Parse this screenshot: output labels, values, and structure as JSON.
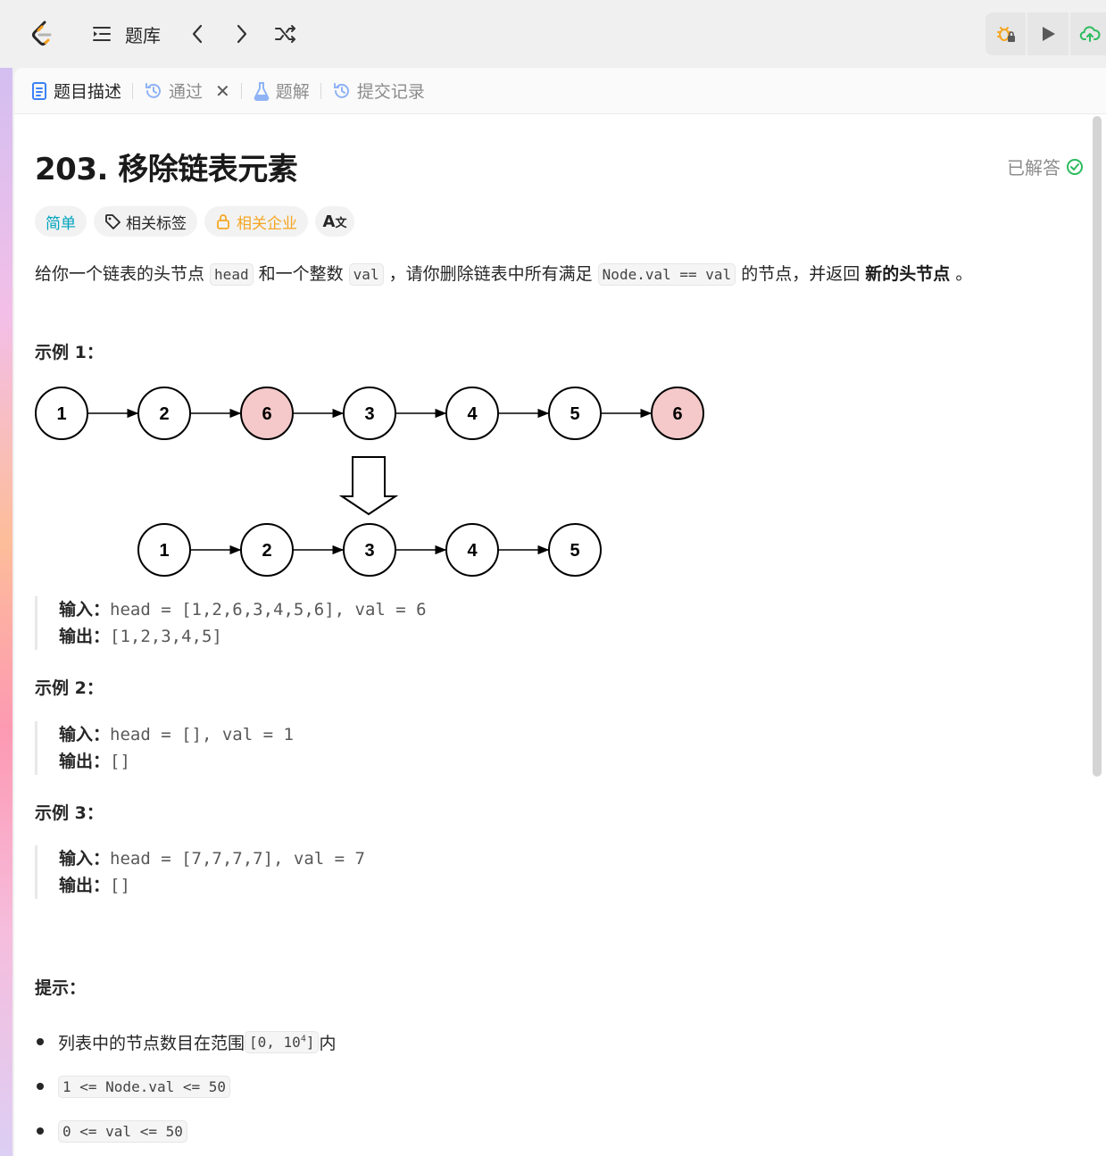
{
  "navbar": {
    "title": "题库",
    "icons": [
      "leetcode-logo",
      "list-icon",
      "chevron-left-icon",
      "chevron-right-icon",
      "shuffle-icon",
      "debug-icon",
      "run-icon",
      "upload-icon"
    ]
  },
  "tabs": [
    {
      "label": "题目描述",
      "icon": "description-icon"
    },
    {
      "label": "通过",
      "icon": "history-icon"
    },
    {
      "label": "题解",
      "icon": "flask-icon"
    },
    {
      "label": "提交记录",
      "icon": "history-icon"
    }
  ],
  "problem": {
    "title": "203. 移除链表元素",
    "status": "已解答",
    "tags": {
      "difficulty": "简单",
      "topics": "相关标签",
      "companies": "相关企业",
      "lang": "A"
    },
    "desc": {
      "p1": "给你一个链表的头节点 ",
      "c1": "head",
      "p2": " 和一个整数 ",
      "c2": "val",
      "p3": " ，请你删除链表中所有满足 ",
      "c3": "Node.val == val",
      "p4": " 的节点，并返回 ",
      "b1": "新的头节点",
      "p5": " 。"
    }
  },
  "diagram": {
    "before": [
      "1",
      "2",
      "6",
      "3",
      "4",
      "5",
      "6"
    ],
    "after": [
      "1",
      "2",
      "3",
      "4",
      "5"
    ]
  },
  "examples": [
    {
      "title": "示例 1：",
      "input_label": "输入：",
      "input": "head = [1,2,6,3,4,5,6], val = 6",
      "output_label": "输出：",
      "output": "[1,2,3,4,5]"
    },
    {
      "title": "示例 2：",
      "input_label": "输入：",
      "input": "head = [], val = 1",
      "output_label": "输出：",
      "output": "[]"
    },
    {
      "title": "示例 3：",
      "input_label": "输入：",
      "input": "head = [7,7,7,7], val = 7",
      "output_label": "输出：",
      "output": "[]"
    }
  ],
  "hints": {
    "title": "提示：",
    "h1_text": "列表中的节点数目在范围 ",
    "h1_code": "[0, 10",
    "h1_sup": "4",
    "h1_code_end": "]",
    "h1_after": " 内",
    "h2_code": "1 <= Node.val <= 50",
    "h3_code": "0 <= val <= 50"
  },
  "colors": {
    "accent_easy": "#00a3bd",
    "company": "#f5a623",
    "solved_check": "#2cbb5d",
    "highlight_node": "#f5c9c9"
  }
}
